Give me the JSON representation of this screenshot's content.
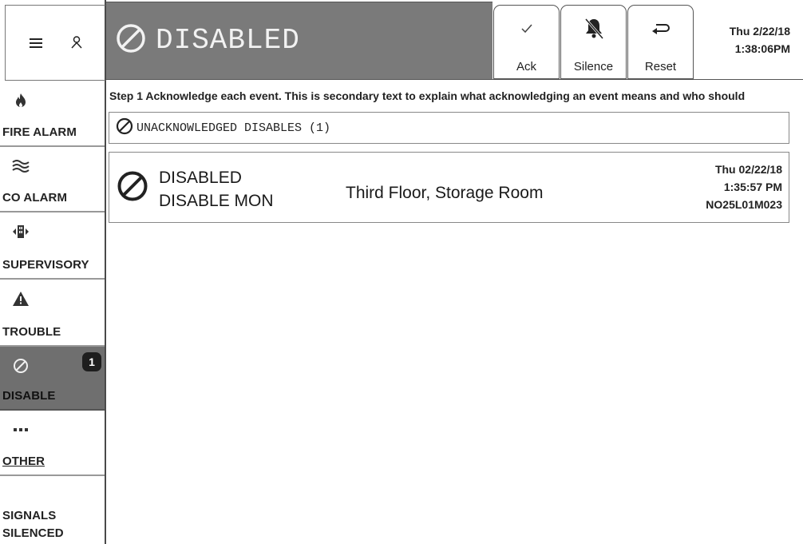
{
  "header": {
    "title": "DISABLED",
    "buttons": [
      {
        "id": "ack",
        "label": "Ack",
        "icon": "check-icon"
      },
      {
        "id": "silence",
        "label": "Silence",
        "icon": "bell-slash-icon"
      },
      {
        "id": "reset",
        "label": "Reset",
        "icon": "return-arrow-icon"
      }
    ],
    "date": "Thu 2/22/18",
    "time": "1:38:06PM"
  },
  "sidebar": {
    "menu_icon": "hamburger-icon",
    "user_icon": "user-icon",
    "items": [
      {
        "label": "FIRE ALARM",
        "icon": "flame-icon"
      },
      {
        "label": "CO ALARM",
        "icon": "waves-icon"
      },
      {
        "label": "SUPERVISORY",
        "icon": "supervisory-icon"
      },
      {
        "label": "TROUBLE",
        "icon": "warning-icon"
      },
      {
        "label": "DISABLE",
        "icon": "disable-icon",
        "badge": "1",
        "active": true
      },
      {
        "label": "OTHER",
        "icon": "more-icon"
      },
      {
        "label": "SIGNALS SILENCED",
        "icon": ""
      }
    ]
  },
  "content": {
    "step_text": "Step 1 Acknowledge each event. This is secondary text to explain what acknowledging an event means and who should",
    "group_header": "UNACKNOWLEDGED DISABLES (1)",
    "events": [
      {
        "status": "DISABLED",
        "type": "DISABLE MON",
        "location": "Third Floor, Storage Room",
        "date": "Thu 02/22/18",
        "time": "1:35:57 PM",
        "device_id": "NO25L01M023"
      }
    ]
  },
  "colors": {
    "header_bg": "#7a7a7a",
    "active_nav_bg": "#6f6f6f",
    "badge_bg": "#1e1e1e"
  }
}
